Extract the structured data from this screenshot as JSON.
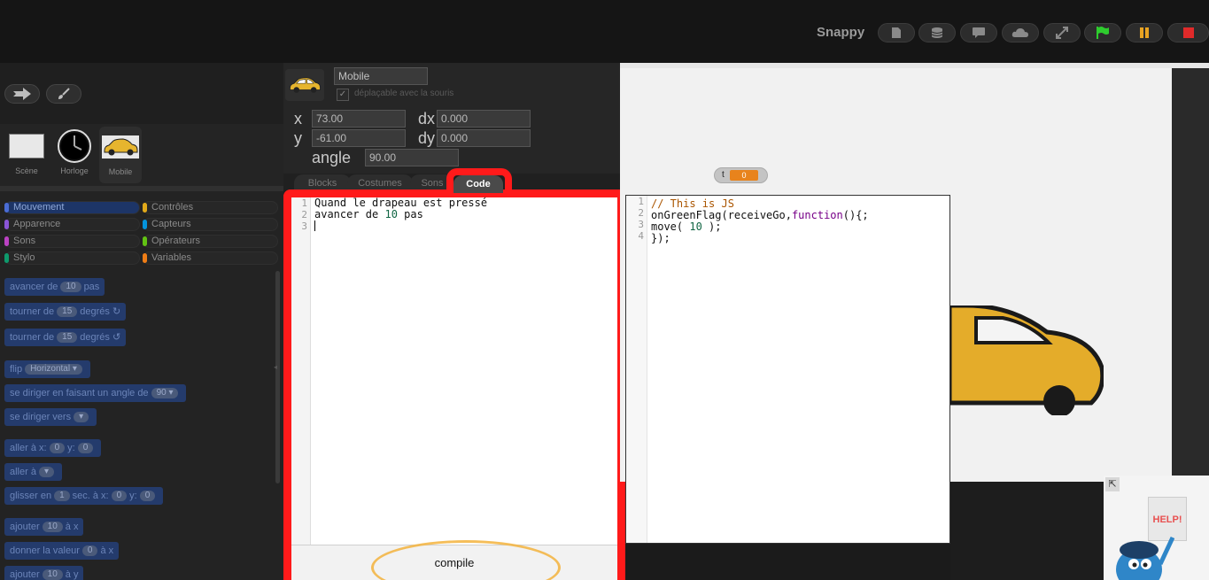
{
  "topbar": {
    "app_title": "Snappy",
    "buttons": [
      {
        "name": "new-project-button",
        "icon": "file-icon"
      },
      {
        "name": "database-button",
        "icon": "database-icon"
      },
      {
        "name": "comment-button",
        "icon": "speech-bubble-icon"
      },
      {
        "name": "cloud-button",
        "icon": "cloud-icon"
      },
      {
        "name": "fullscreen-button",
        "icon": "expand-icon"
      },
      {
        "name": "green-flag-button",
        "icon": "flag-icon"
      },
      {
        "name": "pause-button",
        "icon": "pause-icon"
      },
      {
        "name": "stop-button",
        "icon": "stop-icon"
      }
    ],
    "colors": {
      "flag": "#2ecc2e",
      "pause": "#e8a322",
      "stop": "#e02a2a"
    }
  },
  "corral": {
    "sprites": [
      {
        "name": "Scène"
      },
      {
        "name": "Horloge"
      },
      {
        "name": "Mobile"
      }
    ]
  },
  "categories": [
    {
      "label": "Mouvement",
      "color": "#4a6cd4",
      "active": true
    },
    {
      "label": "Contrôles",
      "color": "#e1a91a"
    },
    {
      "label": "Apparence",
      "color": "#8a55d7"
    },
    {
      "label": "Capteurs",
      "color": "#0494dc"
    },
    {
      "label": "Sons",
      "color": "#bb42c3"
    },
    {
      "label": "Opérateurs",
      "color": "#62c213"
    },
    {
      "label": "Stylo",
      "color": "#0e9a6c"
    },
    {
      "label": "Variables",
      "color": "#ee7d16"
    }
  ],
  "palette": {
    "b1": {
      "pre": "avancer de",
      "slot": "10",
      "post": "pas"
    },
    "b2": {
      "pre": "tourner de",
      "slot": "15",
      "post": "degrés ↻"
    },
    "b3": {
      "pre": "tourner de",
      "slot": "15",
      "post": "degrés ↺"
    },
    "b4": {
      "pre": "flip",
      "slot": "Horizontal ▾"
    },
    "b5": {
      "pre": "se diriger en faisant un angle de",
      "slot": "90 ▾"
    },
    "b6": {
      "pre": "se diriger vers",
      "slot": "▾"
    },
    "b7": {
      "pre": "aller à x:",
      "slot": "0",
      "mid": "y:",
      "slot2": "0"
    },
    "b8": {
      "pre": "aller à",
      "slot": "▾"
    },
    "b9": {
      "pre": "glisser en",
      "slot": "1",
      "mid": "sec. à x:",
      "slot2": "0",
      "mid2": "y:",
      "slot3": "0"
    },
    "b10": {
      "pre": "ajouter",
      "slot": "10",
      "post": "à x"
    },
    "b11": {
      "pre": "donner la valeur",
      "slot": "0",
      "post": "à x"
    },
    "b12": {
      "pre": "ajouter",
      "slot": "10",
      "post": "à y"
    }
  },
  "sprite": {
    "name": "Mobile",
    "draggable_label": "déplaçable avec la souris",
    "x_label": "x",
    "x": "73.00",
    "y_label": "y",
    "y": "-61.00",
    "dx_label": "dx",
    "dx": "0.000",
    "dy_label": "dy",
    "dy": "0.000",
    "angle_label": "angle",
    "angle": "90.00"
  },
  "tabs": [
    "Blocks",
    "Costumes",
    "Sons",
    "Code"
  ],
  "editor": {
    "line_numbers": [
      "1",
      "2",
      "3"
    ],
    "line1": "Quand le drapeau est pressé",
    "line2_pre": "avancer de ",
    "line2_num": "10",
    "line2_post": " pas",
    "compile_label": "compile"
  },
  "stage": {
    "watcher_label": "t",
    "watcher_value": "0"
  },
  "js_code": {
    "line_numbers": [
      "1",
      "2",
      "3",
      "4"
    ],
    "comment": "// This is JS",
    "l2_pre": "onGreenFlag(receiveGo,",
    "l2_kw": "function",
    "l2_post": "(){;",
    "l3_pre": "move( ",
    "l3_num": "10",
    "l3_post": " );",
    "l4": "});"
  },
  "help": {
    "sign": "HELP!"
  }
}
